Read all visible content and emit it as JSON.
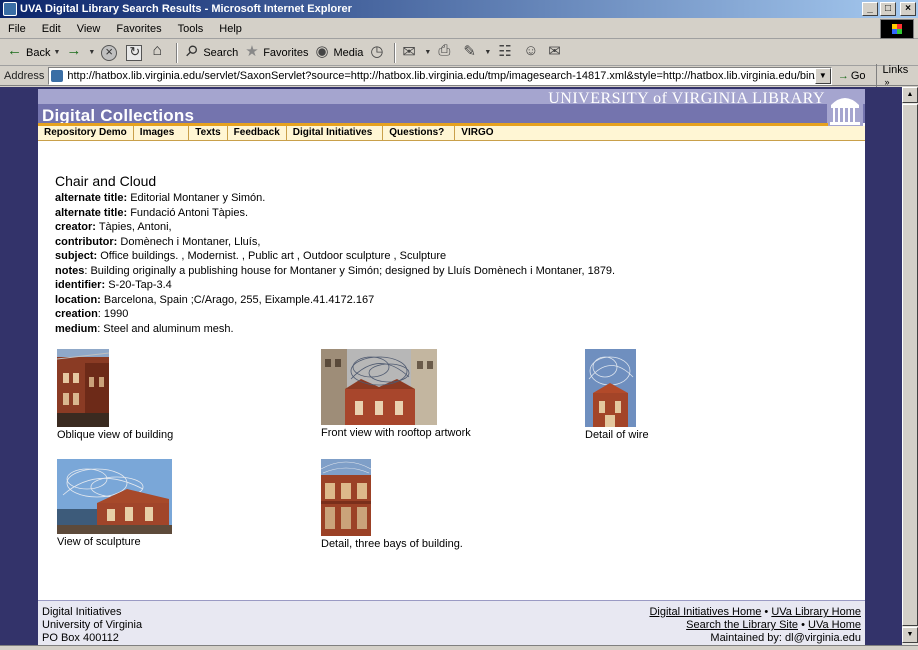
{
  "window": {
    "title": "UVA Digital Library Search Results - Microsoft Internet Explorer",
    "buttons": [
      "_",
      "□",
      "×"
    ]
  },
  "menubar": [
    "File",
    "Edit",
    "View",
    "Favorites",
    "Tools",
    "Help"
  ],
  "toolbar": {
    "back": "Back",
    "search": "Search",
    "favorites": "Favorites",
    "media": "Media"
  },
  "addressbar": {
    "label": "Address",
    "url": "http://hatbox.lib.virginia.edu/servlet/SaxonServlet?source=http://hatbox.lib.virginia.edu/tmp/imagesearch-14817.xml&style=http://hatbox.lib.virginia.edu/bin/xsl/imagegdms",
    "go": "Go",
    "links": "Links"
  },
  "banner": {
    "title": "Digital Collections",
    "institution": "UNIVERSITY of VIRGINIA LIBRARY"
  },
  "nav": [
    "Repository Demo",
    "Images",
    "Texts",
    "Feedback",
    "Digital Initiatives",
    "Questions?",
    "VIRGO"
  ],
  "record": {
    "title": "Chair and Cloud",
    "fields": [
      {
        "label": "alternate title:",
        "value": "Editorial Montaner y Simón."
      },
      {
        "label": "alternate title:",
        "value": "Fundació Antoni Tàpies."
      },
      {
        "label": "creator:",
        "value": "Tàpies, Antoni,"
      },
      {
        "label": "contributor:",
        "value": "Domènech i Montaner, Lluís,"
      },
      {
        "label": "subject:",
        "value": "Office buildings. ,  Modernist. ,  Public art ,  Outdoor sculpture ,  Sculpture"
      },
      {
        "label": "notes",
        "value": ":  Building originally a publishing house for Montaner y Simón; designed by Lluís Domènech i Montaner, 1879."
      },
      {
        "label": "identifier:",
        "value": "S-20-Tap-3.4"
      },
      {
        "label": "location:",
        "value": "Barcelona, Spain ;C/Arago, 255, Eixample.41.4172.167"
      },
      {
        "label": "creation",
        "value": ":  1990"
      },
      {
        "label": "medium",
        "value": ":  Steel and aluminum mesh."
      }
    ]
  },
  "images": [
    {
      "caption": "Oblique view of building"
    },
    {
      "caption": "Front view with rooftop artwork"
    },
    {
      "caption": "Detail of wire"
    },
    {
      "caption": "View of sculpture"
    },
    {
      "caption": "Detail, three bays of building."
    }
  ],
  "footer": {
    "left": [
      "Digital Initiatives",
      "University of Virginia",
      "PO Box 400112"
    ],
    "links": {
      "di_home": "Digital Initiatives Home",
      "bullet": "•",
      "uva_lib": "UVa Library Home",
      "search_site": "Search the Library Site",
      "uva_home": "UVa Home",
      "maintained": "Maintained by: dl@virginia.edu"
    }
  }
}
